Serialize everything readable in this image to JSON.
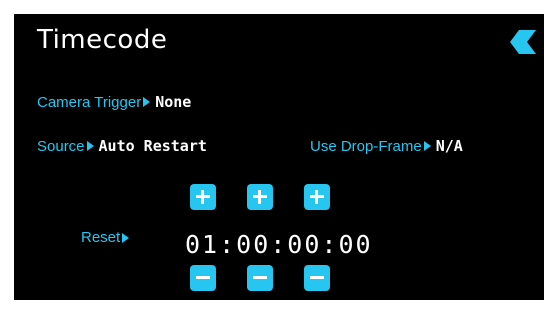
{
  "header": {
    "title": "Timecode",
    "back_icon": "back-chevron-icon"
  },
  "camera_trigger": {
    "label": "Camera Trigger",
    "value": "None"
  },
  "source": {
    "label": "Source",
    "value": "Auto Restart"
  },
  "drop_frame": {
    "label": "Use Drop-Frame",
    "value": "N/A"
  },
  "reset": {
    "label": "Reset"
  },
  "timecode": {
    "value": "01:00:00:00"
  },
  "colors": {
    "accent": "#26c6f0",
    "background": "#000000",
    "text": "#ffffff"
  }
}
